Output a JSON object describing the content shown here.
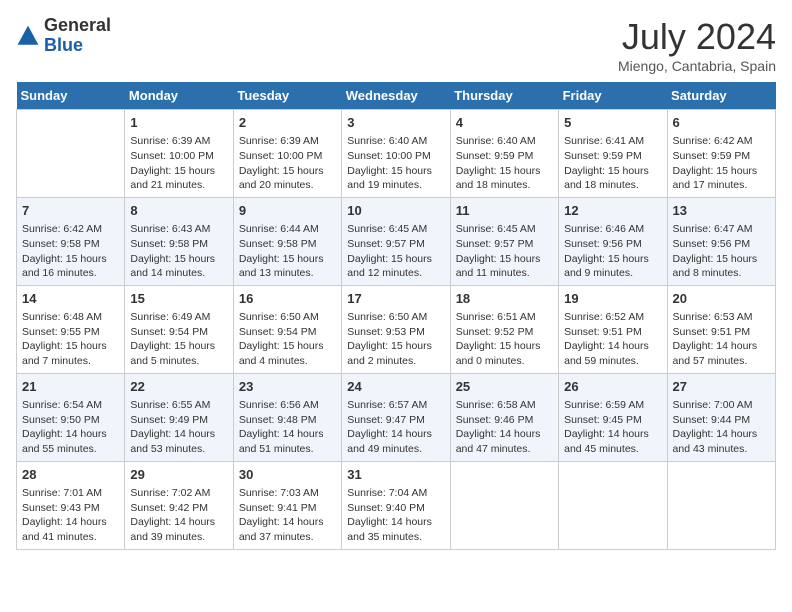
{
  "logo": {
    "general": "General",
    "blue": "Blue"
  },
  "title": {
    "month_year": "July 2024",
    "location": "Miengo, Cantabria, Spain"
  },
  "days_of_week": [
    "Sunday",
    "Monday",
    "Tuesday",
    "Wednesday",
    "Thursday",
    "Friday",
    "Saturday"
  ],
  "weeks": [
    [
      {
        "day": "",
        "info": ""
      },
      {
        "day": "1",
        "info": "Sunrise: 6:39 AM\nSunset: 10:00 PM\nDaylight: 15 hours\nand 21 minutes."
      },
      {
        "day": "2",
        "info": "Sunrise: 6:39 AM\nSunset: 10:00 PM\nDaylight: 15 hours\nand 20 minutes."
      },
      {
        "day": "3",
        "info": "Sunrise: 6:40 AM\nSunset: 10:00 PM\nDaylight: 15 hours\nand 19 minutes."
      },
      {
        "day": "4",
        "info": "Sunrise: 6:40 AM\nSunset: 9:59 PM\nDaylight: 15 hours\nand 18 minutes."
      },
      {
        "day": "5",
        "info": "Sunrise: 6:41 AM\nSunset: 9:59 PM\nDaylight: 15 hours\nand 18 minutes."
      },
      {
        "day": "6",
        "info": "Sunrise: 6:42 AM\nSunset: 9:59 PM\nDaylight: 15 hours\nand 17 minutes."
      }
    ],
    [
      {
        "day": "7",
        "info": "Sunrise: 6:42 AM\nSunset: 9:58 PM\nDaylight: 15 hours\nand 16 minutes."
      },
      {
        "day": "8",
        "info": "Sunrise: 6:43 AM\nSunset: 9:58 PM\nDaylight: 15 hours\nand 14 minutes."
      },
      {
        "day": "9",
        "info": "Sunrise: 6:44 AM\nSunset: 9:58 PM\nDaylight: 15 hours\nand 13 minutes."
      },
      {
        "day": "10",
        "info": "Sunrise: 6:45 AM\nSunset: 9:57 PM\nDaylight: 15 hours\nand 12 minutes."
      },
      {
        "day": "11",
        "info": "Sunrise: 6:45 AM\nSunset: 9:57 PM\nDaylight: 15 hours\nand 11 minutes."
      },
      {
        "day": "12",
        "info": "Sunrise: 6:46 AM\nSunset: 9:56 PM\nDaylight: 15 hours\nand 9 minutes."
      },
      {
        "day": "13",
        "info": "Sunrise: 6:47 AM\nSunset: 9:56 PM\nDaylight: 15 hours\nand 8 minutes."
      }
    ],
    [
      {
        "day": "14",
        "info": "Sunrise: 6:48 AM\nSunset: 9:55 PM\nDaylight: 15 hours\nand 7 minutes."
      },
      {
        "day": "15",
        "info": "Sunrise: 6:49 AM\nSunset: 9:54 PM\nDaylight: 15 hours\nand 5 minutes."
      },
      {
        "day": "16",
        "info": "Sunrise: 6:50 AM\nSunset: 9:54 PM\nDaylight: 15 hours\nand 4 minutes."
      },
      {
        "day": "17",
        "info": "Sunrise: 6:50 AM\nSunset: 9:53 PM\nDaylight: 15 hours\nand 2 minutes."
      },
      {
        "day": "18",
        "info": "Sunrise: 6:51 AM\nSunset: 9:52 PM\nDaylight: 15 hours\nand 0 minutes."
      },
      {
        "day": "19",
        "info": "Sunrise: 6:52 AM\nSunset: 9:51 PM\nDaylight: 14 hours\nand 59 minutes."
      },
      {
        "day": "20",
        "info": "Sunrise: 6:53 AM\nSunset: 9:51 PM\nDaylight: 14 hours\nand 57 minutes."
      }
    ],
    [
      {
        "day": "21",
        "info": "Sunrise: 6:54 AM\nSunset: 9:50 PM\nDaylight: 14 hours\nand 55 minutes."
      },
      {
        "day": "22",
        "info": "Sunrise: 6:55 AM\nSunset: 9:49 PM\nDaylight: 14 hours\nand 53 minutes."
      },
      {
        "day": "23",
        "info": "Sunrise: 6:56 AM\nSunset: 9:48 PM\nDaylight: 14 hours\nand 51 minutes."
      },
      {
        "day": "24",
        "info": "Sunrise: 6:57 AM\nSunset: 9:47 PM\nDaylight: 14 hours\nand 49 minutes."
      },
      {
        "day": "25",
        "info": "Sunrise: 6:58 AM\nSunset: 9:46 PM\nDaylight: 14 hours\nand 47 minutes."
      },
      {
        "day": "26",
        "info": "Sunrise: 6:59 AM\nSunset: 9:45 PM\nDaylight: 14 hours\nand 45 minutes."
      },
      {
        "day": "27",
        "info": "Sunrise: 7:00 AM\nSunset: 9:44 PM\nDaylight: 14 hours\nand 43 minutes."
      }
    ],
    [
      {
        "day": "28",
        "info": "Sunrise: 7:01 AM\nSunset: 9:43 PM\nDaylight: 14 hours\nand 41 minutes."
      },
      {
        "day": "29",
        "info": "Sunrise: 7:02 AM\nSunset: 9:42 PM\nDaylight: 14 hours\nand 39 minutes."
      },
      {
        "day": "30",
        "info": "Sunrise: 7:03 AM\nSunset: 9:41 PM\nDaylight: 14 hours\nand 37 minutes."
      },
      {
        "day": "31",
        "info": "Sunrise: 7:04 AM\nSunset: 9:40 PM\nDaylight: 14 hours\nand 35 minutes."
      },
      {
        "day": "",
        "info": ""
      },
      {
        "day": "",
        "info": ""
      },
      {
        "day": "",
        "info": ""
      }
    ]
  ]
}
